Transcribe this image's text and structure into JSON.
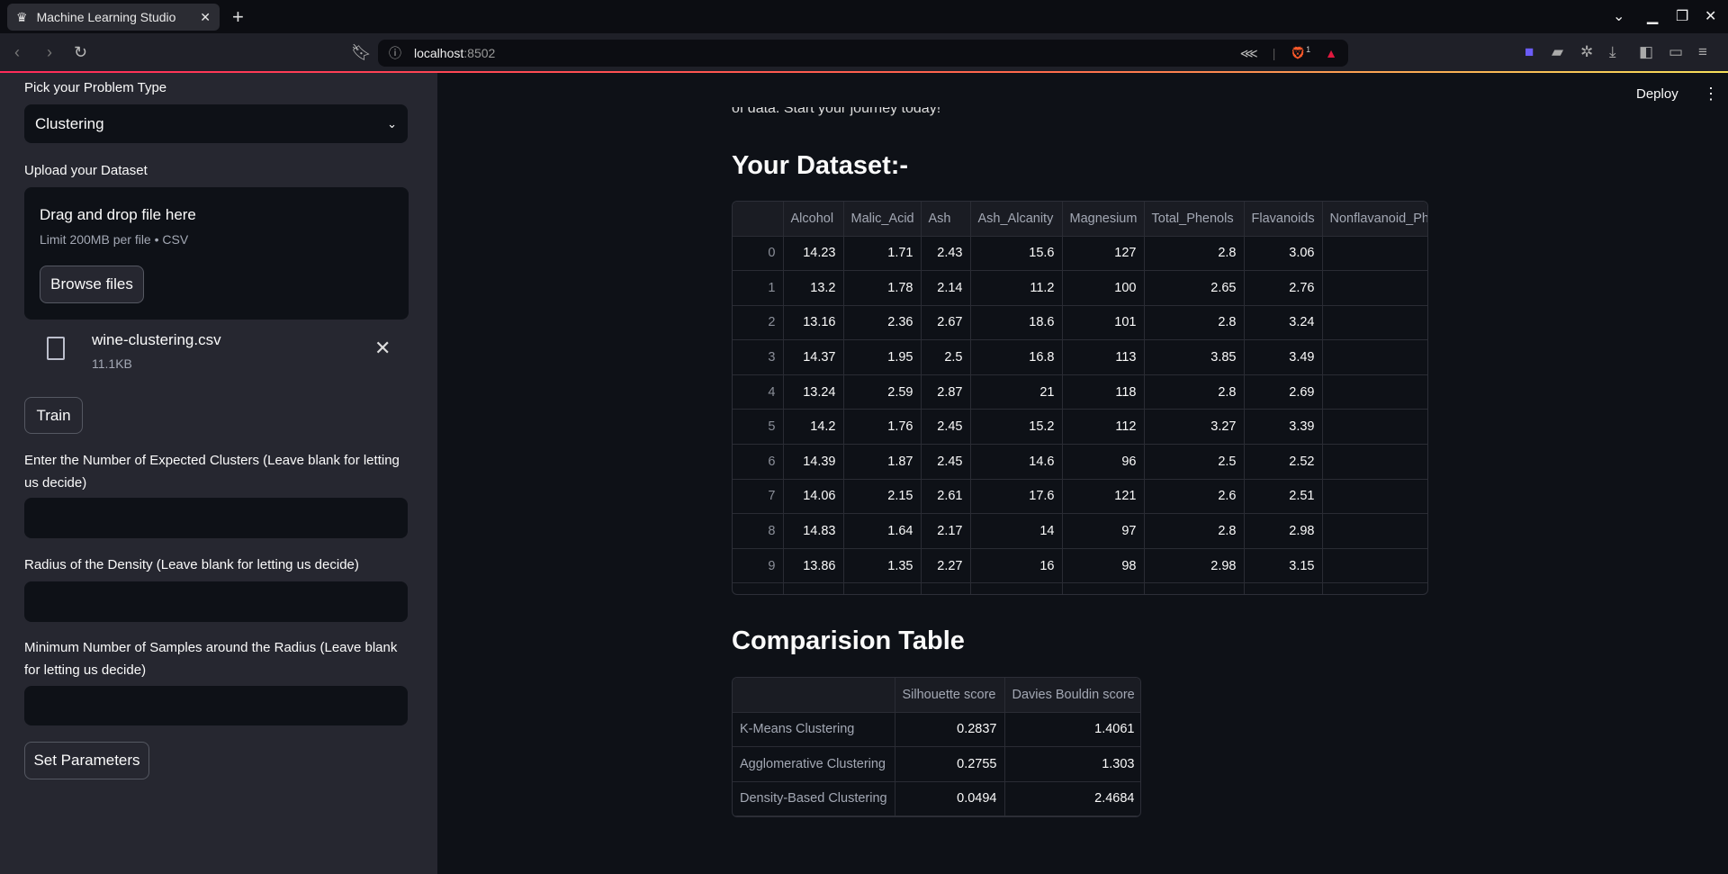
{
  "browser": {
    "tab_title": "Machine Learning Studio",
    "url_host": "localhost",
    "url_port": ":8502",
    "shields_badge": "1"
  },
  "sidebar": {
    "problem_type_label": "Pick your Problem Type",
    "problem_type_value": "Clustering",
    "upload_label": "Upload your Dataset",
    "dropzone_title": "Drag and drop file here",
    "dropzone_limit": "Limit 200MB per file • CSV",
    "browse_label": "Browse files",
    "file": {
      "name": "wine-clustering.csv",
      "size": "11.1KB"
    },
    "train_label": "Train",
    "clusters_label": "Enter the Number of Expected Clusters (Leave blank for letting us decide)",
    "clusters_value": "",
    "radius_label": "Radius of the Density (Leave blank for letting us decide)",
    "radius_value": "",
    "min_samples_label": "Minimum Number of Samples around the Radius (Leave blank for letting us decide)",
    "min_samples_value": "",
    "set_params_label": "Set Parameters"
  },
  "header": {
    "deploy_label": "Deploy"
  },
  "main": {
    "intro_fragment": "of data. Start your journey today!",
    "dataset_heading": "Your Dataset:-",
    "dataset": {
      "columns": [
        "",
        "Alcohol",
        "Malic_Acid",
        "Ash",
        "Ash_Alcanity",
        "Magnesium",
        "Total_Phenols",
        "Flavanoids",
        "Nonflavanoid_Ph"
      ],
      "rows": [
        [
          "0",
          "14.23",
          "1.71",
          "2.43",
          "15.6",
          "127",
          "2.8",
          "3.06",
          ""
        ],
        [
          "1",
          "13.2",
          "1.78",
          "2.14",
          "11.2",
          "100",
          "2.65",
          "2.76",
          ""
        ],
        [
          "2",
          "13.16",
          "2.36",
          "2.67",
          "18.6",
          "101",
          "2.8",
          "3.24",
          ""
        ],
        [
          "3",
          "14.37",
          "1.95",
          "2.5",
          "16.8",
          "113",
          "3.85",
          "3.49",
          ""
        ],
        [
          "4",
          "13.24",
          "2.59",
          "2.87",
          "21",
          "118",
          "2.8",
          "2.69",
          ""
        ],
        [
          "5",
          "14.2",
          "1.76",
          "2.45",
          "15.2",
          "112",
          "3.27",
          "3.39",
          ""
        ],
        [
          "6",
          "14.39",
          "1.87",
          "2.45",
          "14.6",
          "96",
          "2.5",
          "2.52",
          ""
        ],
        [
          "7",
          "14.06",
          "2.15",
          "2.61",
          "17.6",
          "121",
          "2.6",
          "2.51",
          ""
        ],
        [
          "8",
          "14.83",
          "1.64",
          "2.17",
          "14",
          "97",
          "2.8",
          "2.98",
          ""
        ],
        [
          "9",
          "13.86",
          "1.35",
          "2.27",
          "16",
          "98",
          "2.98",
          "3.15",
          ""
        ]
      ]
    },
    "comparison_heading": "Comparision Table",
    "comparison": {
      "columns": [
        "",
        "Silhouette score",
        "Davies Bouldin score"
      ],
      "rows": [
        [
          "K-Means Clustering",
          "0.2837",
          "1.4061"
        ],
        [
          "Agglomerative Clustering",
          "0.2755",
          "1.303"
        ],
        [
          "Density-Based Clustering",
          "0.0494",
          "2.4684"
        ]
      ]
    }
  },
  "colors": {
    "background": "#0e1117",
    "sidebar": "#262730",
    "accent": "#ff4b4b"
  }
}
